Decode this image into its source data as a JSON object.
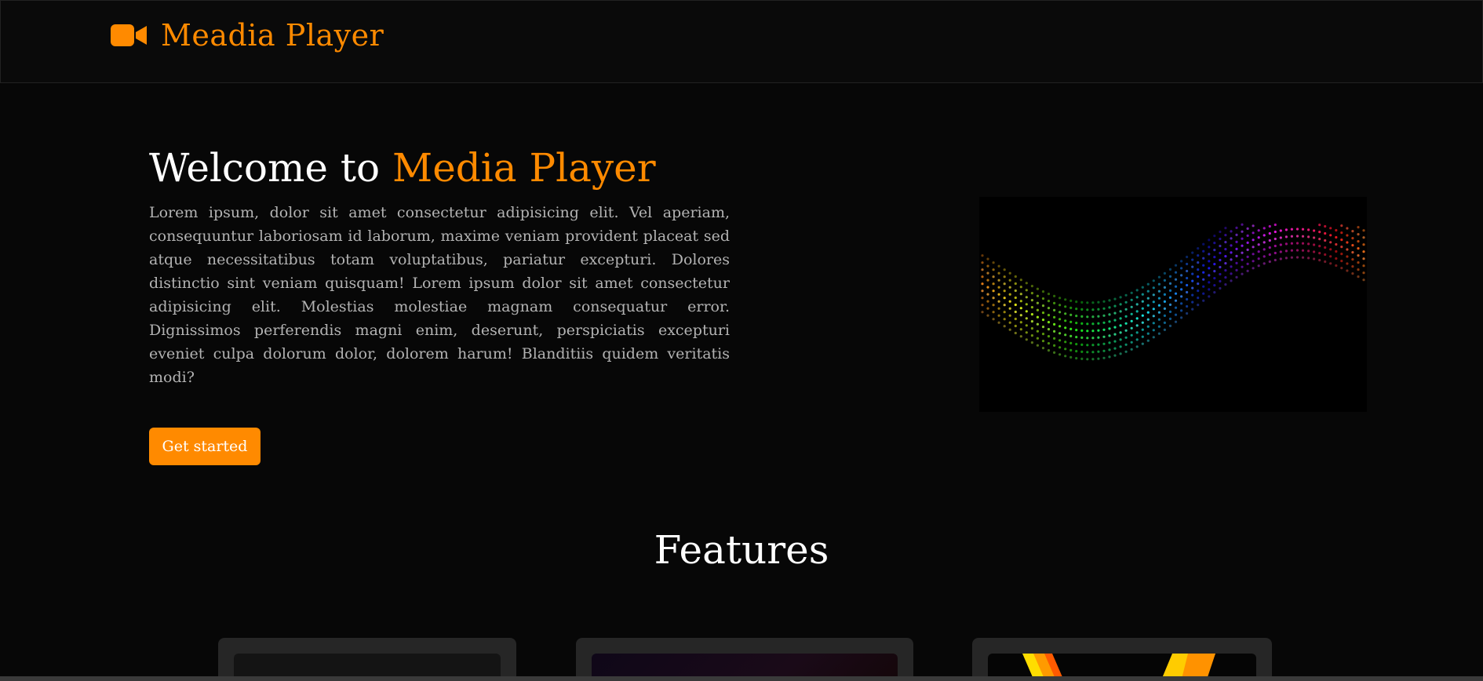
{
  "header": {
    "brand_name": "Meadia Player",
    "brand_icon": "video-camera-icon",
    "brand_color": "#ff8a00"
  },
  "hero": {
    "title_prefix": "Welcome to ",
    "title_accent": "Media Player",
    "description": "Lorem ipsum, dolor sit amet consectetur adipisicing elit. Vel aperiam, consequuntur laboriosam id laborum, maxime veniam provident placeat sed atque necessitatibus totam voluptatibus, pariatur excepturi. Dolores distinctio sint veniam quisquam! Lorem ipsum dolor sit amet consectetur adipisicing elit. Molestias molestiae magnam consequatur error. Dignissimos perferendis magni enim, deserunt, perspiciatis excepturi eveniet culpa dolorum dolor, dolorem harum! Blanditiis quidem veritatis modi?",
    "cta_label": "Get started",
    "image": "colorful-dot-wave-visualization"
  },
  "features": {
    "title": "Features",
    "cards": [
      {
        "image": "dark-preview"
      },
      {
        "image": "purple-gradient-preview"
      },
      {
        "image": "yellow-orange-stripes-preview"
      }
    ]
  },
  "colors": {
    "accent": "#ff8a00",
    "background": "#070707",
    "text_muted": "#b3b3b3"
  }
}
